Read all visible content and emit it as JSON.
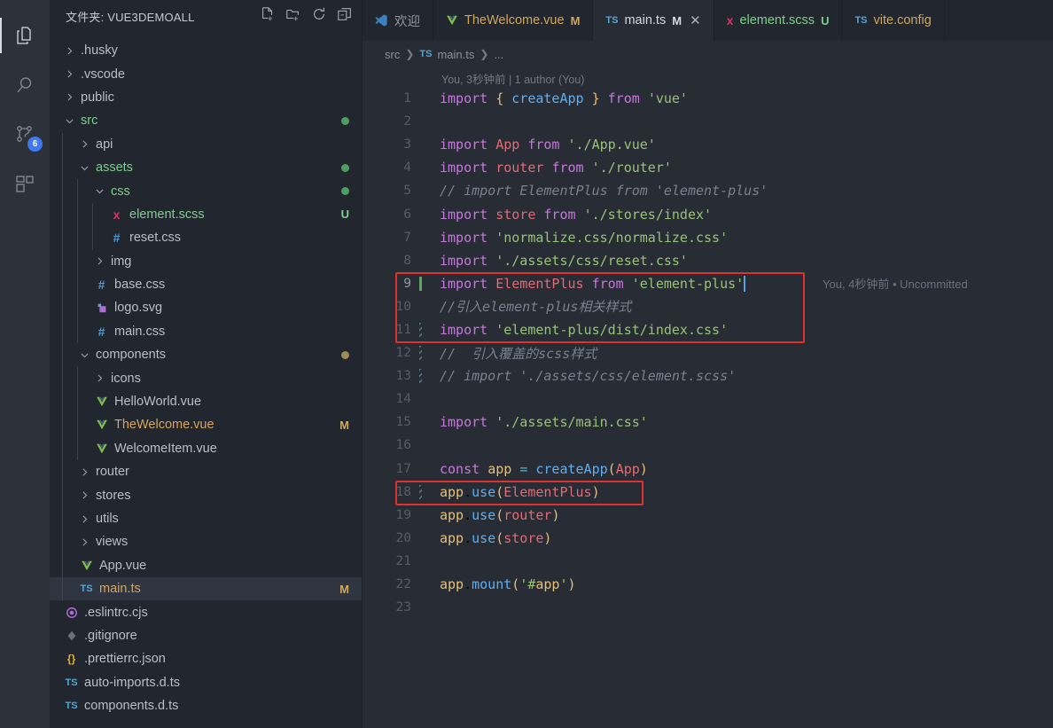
{
  "activity_bar": {
    "items": [
      {
        "name": "explorer",
        "icon": "files-icon",
        "active": true,
        "badge": null
      },
      {
        "name": "search",
        "icon": "search-icon",
        "active": false,
        "badge": null
      },
      {
        "name": "source-control",
        "icon": "source-control-icon",
        "active": false,
        "badge": "6"
      },
      {
        "name": "extensions",
        "icon": "extensions-icon",
        "active": false,
        "badge": null
      }
    ]
  },
  "sidebar": {
    "title": "文件夹: VUE3DEMOALL",
    "actions": [
      {
        "name": "new-file-icon",
        "tooltip": "新建文件"
      },
      {
        "name": "new-folder-icon",
        "tooltip": "新建文件夹"
      },
      {
        "name": "refresh-icon",
        "tooltip": "刷新"
      },
      {
        "name": "collapse-all-icon",
        "tooltip": "全部折叠"
      }
    ],
    "tree": [
      {
        "label": ".husky",
        "depth": 0,
        "type": "folder",
        "expanded": false,
        "icon": "chevron-right-icon",
        "deco": "",
        "dot": ""
      },
      {
        "label": ".vscode",
        "depth": 0,
        "type": "folder",
        "expanded": false,
        "icon": "chevron-right-icon",
        "deco": "",
        "dot": ""
      },
      {
        "label": "public",
        "depth": 0,
        "type": "folder",
        "expanded": false,
        "icon": "chevron-right-icon",
        "deco": "",
        "dot": ""
      },
      {
        "label": "src",
        "depth": 0,
        "type": "folder",
        "expanded": true,
        "icon": "chevron-down-icon",
        "deco": "",
        "dot": "#4d9e62",
        "color": "green"
      },
      {
        "label": "api",
        "depth": 1,
        "type": "folder",
        "expanded": false,
        "icon": "chevron-right-icon",
        "deco": "",
        "dot": ""
      },
      {
        "label": "assets",
        "depth": 1,
        "type": "folder",
        "expanded": true,
        "icon": "chevron-down-icon",
        "deco": "",
        "dot": "#4d9e62",
        "color": "green"
      },
      {
        "label": "css",
        "depth": 2,
        "type": "folder",
        "expanded": true,
        "icon": "chevron-down-icon",
        "deco": "",
        "dot": "#4d9e62",
        "color": "green"
      },
      {
        "label": "element.scss",
        "depth": 3,
        "type": "file",
        "icon": "scss-icon",
        "deco": "U",
        "deco_kind": "untracked",
        "color": "green"
      },
      {
        "label": "reset.css",
        "depth": 3,
        "type": "file",
        "icon": "css-icon",
        "deco": "",
        "dot": ""
      },
      {
        "label": "img",
        "depth": 2,
        "type": "folder",
        "expanded": false,
        "icon": "chevron-right-icon",
        "deco": "",
        "dot": ""
      },
      {
        "label": "base.css",
        "depth": 2,
        "type": "file",
        "icon": "css-icon",
        "deco": "",
        "dot": ""
      },
      {
        "label": "logo.svg",
        "depth": 2,
        "type": "file",
        "icon": "svg-icon",
        "deco": "",
        "dot": ""
      },
      {
        "label": "main.css",
        "depth": 2,
        "type": "file",
        "icon": "css-icon",
        "deco": "",
        "dot": ""
      },
      {
        "label": "components",
        "depth": 1,
        "type": "folder",
        "expanded": true,
        "icon": "chevron-down-icon",
        "deco": "",
        "dot": "#a08a55"
      },
      {
        "label": "icons",
        "depth": 2,
        "type": "folder",
        "expanded": false,
        "icon": "chevron-right-icon",
        "deco": "",
        "dot": ""
      },
      {
        "label": "HelloWorld.vue",
        "depth": 2,
        "type": "file",
        "icon": "vue-icon",
        "deco": "",
        "dot": ""
      },
      {
        "label": "TheWelcome.vue",
        "depth": 2,
        "type": "file",
        "icon": "vue-icon",
        "deco": "M",
        "deco_kind": "modified",
        "color": "modified"
      },
      {
        "label": "WelcomeItem.vue",
        "depth": 2,
        "type": "file",
        "icon": "vue-icon",
        "deco": "",
        "dot": ""
      },
      {
        "label": "router",
        "depth": 1,
        "type": "folder",
        "expanded": false,
        "icon": "chevron-right-icon",
        "deco": "",
        "dot": ""
      },
      {
        "label": "stores",
        "depth": 1,
        "type": "folder",
        "expanded": false,
        "icon": "chevron-right-icon",
        "deco": "",
        "dot": ""
      },
      {
        "label": "utils",
        "depth": 1,
        "type": "folder",
        "expanded": false,
        "icon": "chevron-right-icon",
        "deco": "",
        "dot": ""
      },
      {
        "label": "views",
        "depth": 1,
        "type": "folder",
        "expanded": false,
        "icon": "chevron-right-icon",
        "deco": "",
        "dot": ""
      },
      {
        "label": "App.vue",
        "depth": 1,
        "type": "file",
        "icon": "vue-icon",
        "deco": "",
        "dot": ""
      },
      {
        "label": "main.ts",
        "depth": 1,
        "type": "file",
        "icon": "ts-icon",
        "deco": "M",
        "deco_kind": "modified",
        "color": "modified",
        "selected": true
      },
      {
        "label": ".eslintrc.cjs",
        "depth": 0,
        "type": "file",
        "icon": "eslint-icon",
        "deco": "",
        "dot": ""
      },
      {
        "label": ".gitignore",
        "depth": 0,
        "type": "file",
        "icon": "git-icon",
        "deco": "",
        "dot": ""
      },
      {
        "label": ".prettierrc.json",
        "depth": 0,
        "type": "file",
        "icon": "json-icon",
        "deco": "",
        "dot": ""
      },
      {
        "label": "auto-imports.d.ts",
        "depth": 0,
        "type": "file",
        "icon": "ts-icon",
        "deco": "",
        "dot": ""
      },
      {
        "label": "components.d.ts",
        "depth": 0,
        "type": "file",
        "icon": "ts-icon",
        "deco": "",
        "dot": ""
      }
    ]
  },
  "tabs": [
    {
      "label": "欢迎",
      "icon": "vscode-icon",
      "type": "",
      "mark": "",
      "active": false,
      "closable": false
    },
    {
      "label": "TheWelcome.vue",
      "icon": "vue-icon",
      "type": "",
      "mark": "M",
      "active": false,
      "closable": false
    },
    {
      "label": "main.ts",
      "icon": "ts-icon",
      "type": "TS",
      "mark": "M",
      "active": true,
      "closable": true,
      "close_glyph": "✕"
    },
    {
      "label": "element.scss",
      "icon": "scss-icon",
      "type": "",
      "mark": "U",
      "active": false,
      "closable": false
    },
    {
      "label": "vite.config",
      "icon": "ts-icon",
      "type": "TS",
      "mark": "",
      "active": false,
      "closable": false
    }
  ],
  "breadcrumb": {
    "items": [
      "src",
      "main.ts",
      "..."
    ],
    "ts_badge": "TS",
    "separator": "❯"
  },
  "editor": {
    "blame_header": "You, 3秒钟前 | 1 author (You)",
    "inline_blame": "You, 4秒钟前 • Uncommitted",
    "lines": [
      {
        "n": "1",
        "text": "import { createApp } from 'vue'"
      },
      {
        "n": "2",
        "text": ""
      },
      {
        "n": "3",
        "text": "import App from './App.vue'"
      },
      {
        "n": "4",
        "text": "import router from './router'"
      },
      {
        "n": "5",
        "text": "// import ElementPlus from 'element-plus'"
      },
      {
        "n": "6",
        "text": "import store from './stores/index'"
      },
      {
        "n": "7",
        "text": "import 'normalize.css/normalize.css'"
      },
      {
        "n": "8",
        "text": "import './assets/css/reset.css'"
      },
      {
        "n": "9",
        "text": "import ElementPlus from 'element-plus'"
      },
      {
        "n": "10",
        "text": "//引入element-plus相关样式"
      },
      {
        "n": "11",
        "text": "import 'element-plus/dist/index.css'"
      },
      {
        "n": "12",
        "text": "//  引入覆盖的scss样式"
      },
      {
        "n": "13",
        "text": "// import './assets/css/element.scss'"
      },
      {
        "n": "14",
        "text": ""
      },
      {
        "n": "15",
        "text": "import './assets/main.css'"
      },
      {
        "n": "16",
        "text": ""
      },
      {
        "n": "17",
        "text": "const app = createApp(App)"
      },
      {
        "n": "18",
        "text": "app.use(ElementPlus)"
      },
      {
        "n": "19",
        "text": "app.use(router)"
      },
      {
        "n": "20",
        "text": "app.use(store)"
      },
      {
        "n": "21",
        "text": ""
      },
      {
        "n": "22",
        "text": "app.mount('#app')"
      },
      {
        "n": "23",
        "text": ""
      }
    ]
  },
  "annotations": {
    "highlight_color": "#e03131",
    "boxes": [
      {
        "name": "highlight-box-imports",
        "lines": "9-11"
      },
      {
        "name": "highlight-box-use",
        "lines": "18"
      }
    ]
  },
  "colors": {
    "editor_background": "#282c34",
    "sidebar_background": "#22262e",
    "activitybar_background": "#2c313a",
    "accent_badge": "#4078f2",
    "keyword": "#c678dd",
    "string": "#98c379",
    "comment": "#7a8290",
    "function": "#61afef"
  }
}
